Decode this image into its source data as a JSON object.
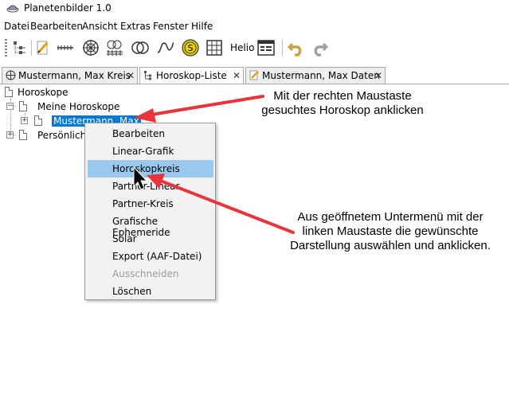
{
  "window": {
    "title": "Planetenbilder 1.0"
  },
  "menubar": [
    "Datei",
    "Bearbeiten",
    "Ansicht",
    "Extras",
    "Fenster",
    "Hilfe"
  ],
  "toolbar": {
    "helio_label": "Helio",
    "s_label": "S"
  },
  "tabs": [
    {
      "label": "Mustermann, Max Kreis",
      "active": false
    },
    {
      "label": "Horoskop-Liste",
      "active": true
    },
    {
      "label": "Mustermann, Max Daten",
      "active": false
    }
  ],
  "tab_close": "✕",
  "tree": {
    "root": "Horoskope",
    "group1": "Meine Horoskope",
    "selected": "Mustermann, Max",
    "group2": "Persönlich",
    "expander_symbol": "+",
    "collapse_symbol": "−"
  },
  "context_menu": [
    {
      "label": "Bearbeiten",
      "state": "normal"
    },
    {
      "label": "Linear-Grafik",
      "state": "normal"
    },
    {
      "label": "Horoskopkreis",
      "state": "highlighted"
    },
    {
      "label": "Partner-Linear",
      "state": "normal"
    },
    {
      "label": "Partner-Kreis",
      "state": "normal"
    },
    {
      "label": "Grafische Ephemeride",
      "state": "normal"
    },
    {
      "label": "Solar",
      "state": "normal"
    },
    {
      "label": "Export (AAF-Datei)",
      "state": "normal"
    },
    {
      "label": "Ausschneiden",
      "state": "disabled"
    },
    {
      "label": "Löschen",
      "state": "normal"
    }
  ],
  "annotations": {
    "top_line1": "Mit der rechten Maustaste",
    "top_line2": "gesuchtes Horoskop anklicken",
    "bottom_line1": "Aus geöffnetem Untermenü mit der",
    "bottom_line2": "linken Maustaste die gewünschte",
    "bottom_line3": "Darstellung auswählen und anklicken."
  },
  "colors": {
    "selection": "#0078d7",
    "menu_highlight": "#99c9ef",
    "arrow": "#e8343b",
    "disabled_text": "#9a9a9a"
  }
}
